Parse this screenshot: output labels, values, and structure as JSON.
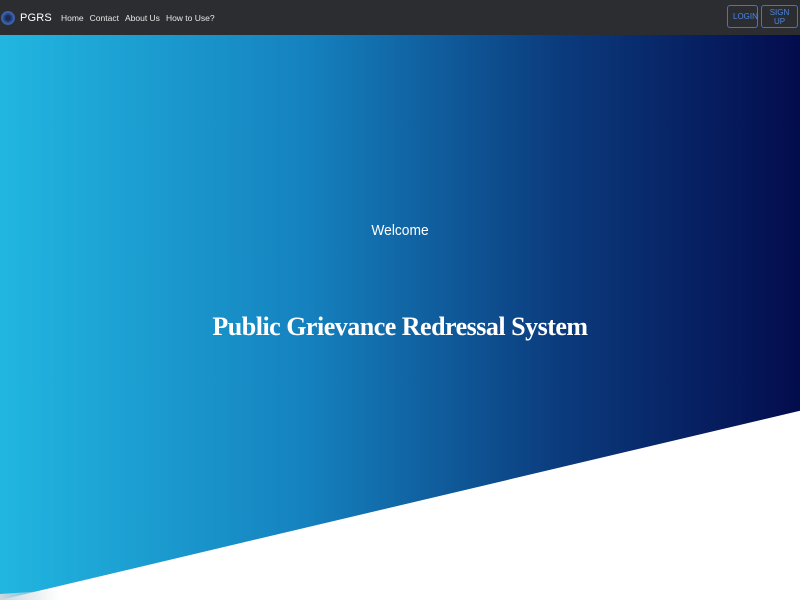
{
  "navbar": {
    "brand": "PGRS",
    "links": [
      "Home",
      "Contact",
      "About Us",
      "How to Use?"
    ],
    "login_label": "LOGIN",
    "signup_label": "SIGN UP",
    "accent_color": "#3f74d0",
    "logo_icon": "globe-logo-icon"
  },
  "hero": {
    "welcome": "Welcome",
    "title": "Public Grievance Redressal System",
    "gradient_colors": [
      "#21b6e0",
      "#1582bf",
      "#0b3b7d",
      "#030c4d"
    ]
  }
}
